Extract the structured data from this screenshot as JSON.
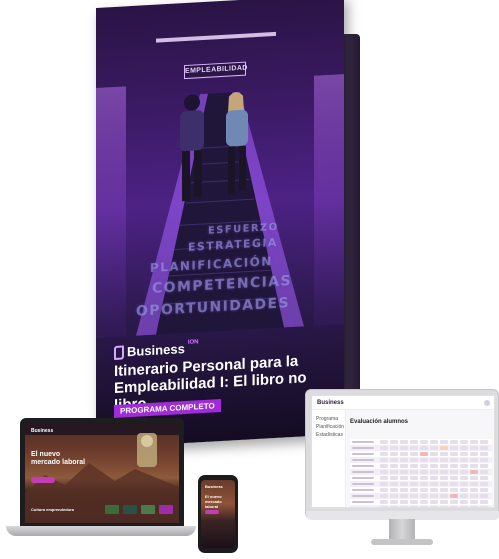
{
  "book": {
    "sign": "EMPLEABILIDAD",
    "wall_words": [
      "ESFUERZO",
      "ESTRATEGIA",
      "PLANIFICACIÓN",
      "COMPETENCIAS",
      "OPORTUNIDADES"
    ],
    "brand": "Business",
    "brand_sup": "ION",
    "title": "Itinerario Personal para la Empleabilidad I: El libro no libro",
    "badge": "PROGRAMA COMPLETO"
  },
  "monitor": {
    "logo": "Business",
    "title": "Evaluación alumnos",
    "nav": [
      "Programa",
      "Planificación",
      "Estadísticas"
    ]
  },
  "laptop": {
    "logo": "Business",
    "headline": "El nuevo mercado laboral",
    "caption": "Cultura emprendedora"
  },
  "phone": {
    "logo": "Business",
    "headline": "El nuevo mercado laboral"
  },
  "colors": {
    "accent": "#a02bd9",
    "cover_dark": "#2a1445",
    "brand_pink": "#c53bb8"
  }
}
